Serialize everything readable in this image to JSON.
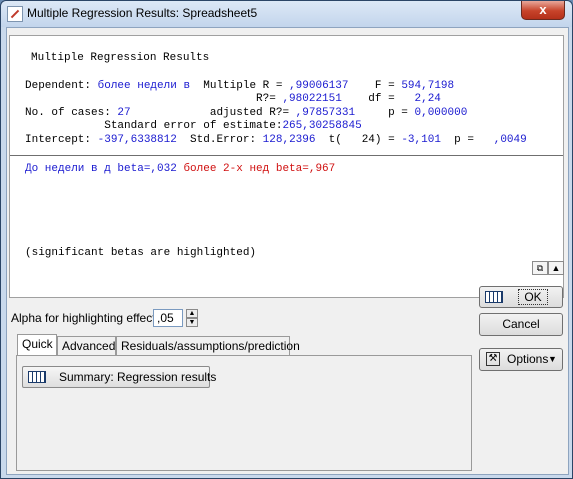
{
  "window": {
    "title": "Multiple Regression Results: Spreadsheet5",
    "close_glyph": "x"
  },
  "results": {
    "heading": "Multiple Regression Results",
    "line1": [
      {
        "t": "Dependent: ",
        "c": "blk"
      },
      {
        "t": "более недели в",
        "c": "blu"
      },
      {
        "t": "  Multiple R = ",
        "c": "blk"
      },
      {
        "t": ",99006137",
        "c": "blu"
      },
      {
        "t": "    F = ",
        "c": "blk"
      },
      {
        "t": "594,7198",
        "c": "blu"
      }
    ],
    "line2": [
      {
        "t": "                                   R?= ",
        "c": "blk"
      },
      {
        "t": ",98022151",
        "c": "blu"
      },
      {
        "t": "    df = ",
        "c": "blk"
      },
      {
        "t": "  2,24",
        "c": "blu"
      }
    ],
    "line3": [
      {
        "t": "No. of cases: ",
        "c": "blk"
      },
      {
        "t": "27",
        "c": "blu"
      },
      {
        "t": "            adjusted R?= ",
        "c": "blk"
      },
      {
        "t": ",97857331",
        "c": "blu"
      },
      {
        "t": "     p = ",
        "c": "blk"
      },
      {
        "t": "0,000000",
        "c": "blu"
      }
    ],
    "line4": [
      {
        "t": "            Standard error of estimate:",
        "c": "blk"
      },
      {
        "t": "265,30258845",
        "c": "blu"
      }
    ],
    "line5": [
      {
        "t": "Intercept: ",
        "c": "blk"
      },
      {
        "t": "-397,6338812",
        "c": "blu"
      },
      {
        "t": "  Std.Error: ",
        "c": "blk"
      },
      {
        "t": "128,2396",
        "c": "blu"
      },
      {
        "t": "  t(   24) = ",
        "c": "blk"
      },
      {
        "t": "-3,101",
        "c": "blu"
      },
      {
        "t": "  p = ",
        "c": "blk"
      },
      {
        "t": "  ,0049",
        "c": "blu"
      }
    ],
    "betas": [
      {
        "t": "До недели в д beta=,032 ",
        "c": "blu"
      },
      {
        "t": "более 2-х нед beta=,967",
        "c": "red"
      }
    ],
    "footnote": "(significant betas are highlighted)"
  },
  "alpha": {
    "label": "Alpha for highlighting effects:",
    "value": ",05"
  },
  "tabs": [
    "Quick",
    "Advanced",
    "Residuals/assumptions/prediction"
  ],
  "summary_button": "Summary:  Regression results",
  "buttons": {
    "ok": "OK",
    "cancel": "Cancel",
    "options": "Options"
  },
  "colors": {
    "blue_value": "#1a1ad0",
    "red_highlight": "#d01010"
  }
}
